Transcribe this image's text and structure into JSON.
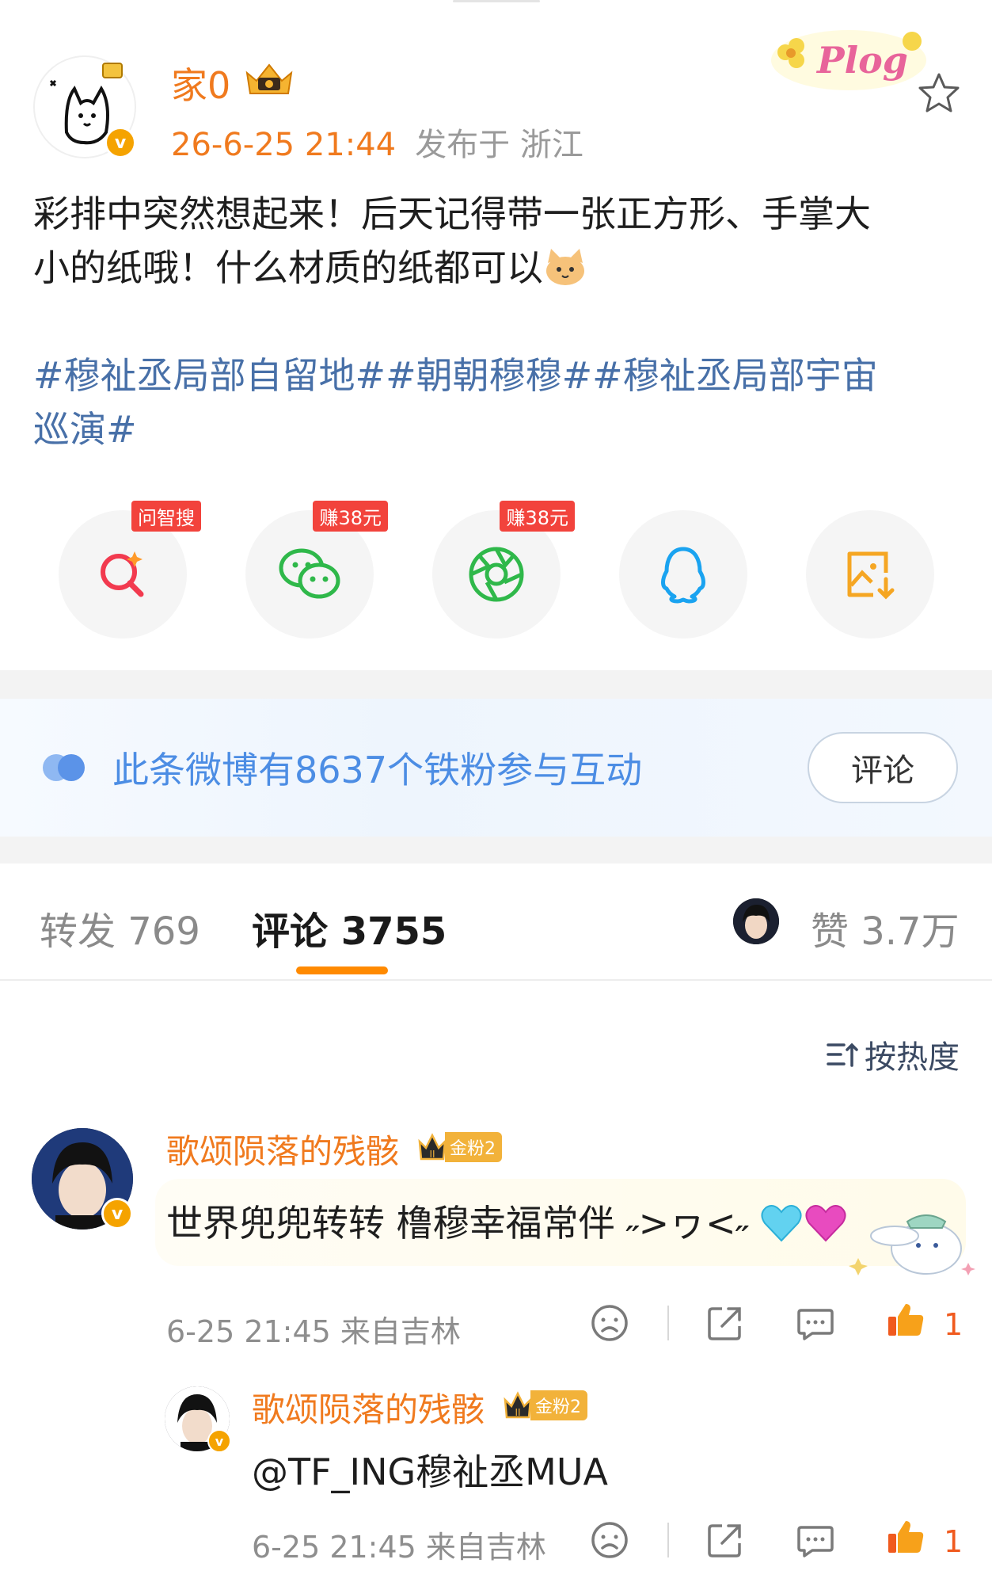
{
  "post": {
    "author": "家0",
    "time": "26-6-25 21:44",
    "location": "发布于 浙江",
    "body_line1": "彩排中突然想起来！后天记得带一张正方形、手掌大",
    "body_line2": "小的纸哦！什么材质的纸都可以",
    "hashtags_line1": "#穆祉丞局部自留地##朝朝穆穆##穆祉丞局部宇宙",
    "hashtags_line2": "巡演#",
    "sticker_text": "Plog"
  },
  "share": [
    {
      "name": "ai-search",
      "tag": "问智搜"
    },
    {
      "name": "wechat",
      "tag": "赚38元"
    },
    {
      "name": "moments",
      "tag": "赚38元"
    },
    {
      "name": "qq",
      "tag": ""
    },
    {
      "name": "save-image",
      "tag": ""
    }
  ],
  "fan_banner": {
    "text": "此条微博有8637个铁粉参与互动",
    "button": "评论"
  },
  "tabs": {
    "repost": "转发 769",
    "comment": "评论 3755",
    "like": "赞 3.7万"
  },
  "sort": {
    "label": "按热度"
  },
  "comments": [
    {
      "user": "歌颂陨落的残骸",
      "badge": "金粉2",
      "text": "世界兜兜转转 橹穆幸福常伴 ˶>ヮ<˶",
      "time_loc": "6-25 21:45  来自吉林",
      "likes": "1"
    },
    {
      "user": "歌颂陨落的残骸",
      "badge": "金粉2",
      "text": "@TF_ING穆祉丞MUA",
      "time_loc": "6-25 21:45  来自吉林",
      "likes": "1"
    }
  ],
  "colors": {
    "accent_orange": "#f07a1e",
    "link_blue": "#4870a8",
    "fan_blue": "#4c8de4",
    "like_red": "#f05a1e",
    "tab_underline": "#ff8a00"
  }
}
